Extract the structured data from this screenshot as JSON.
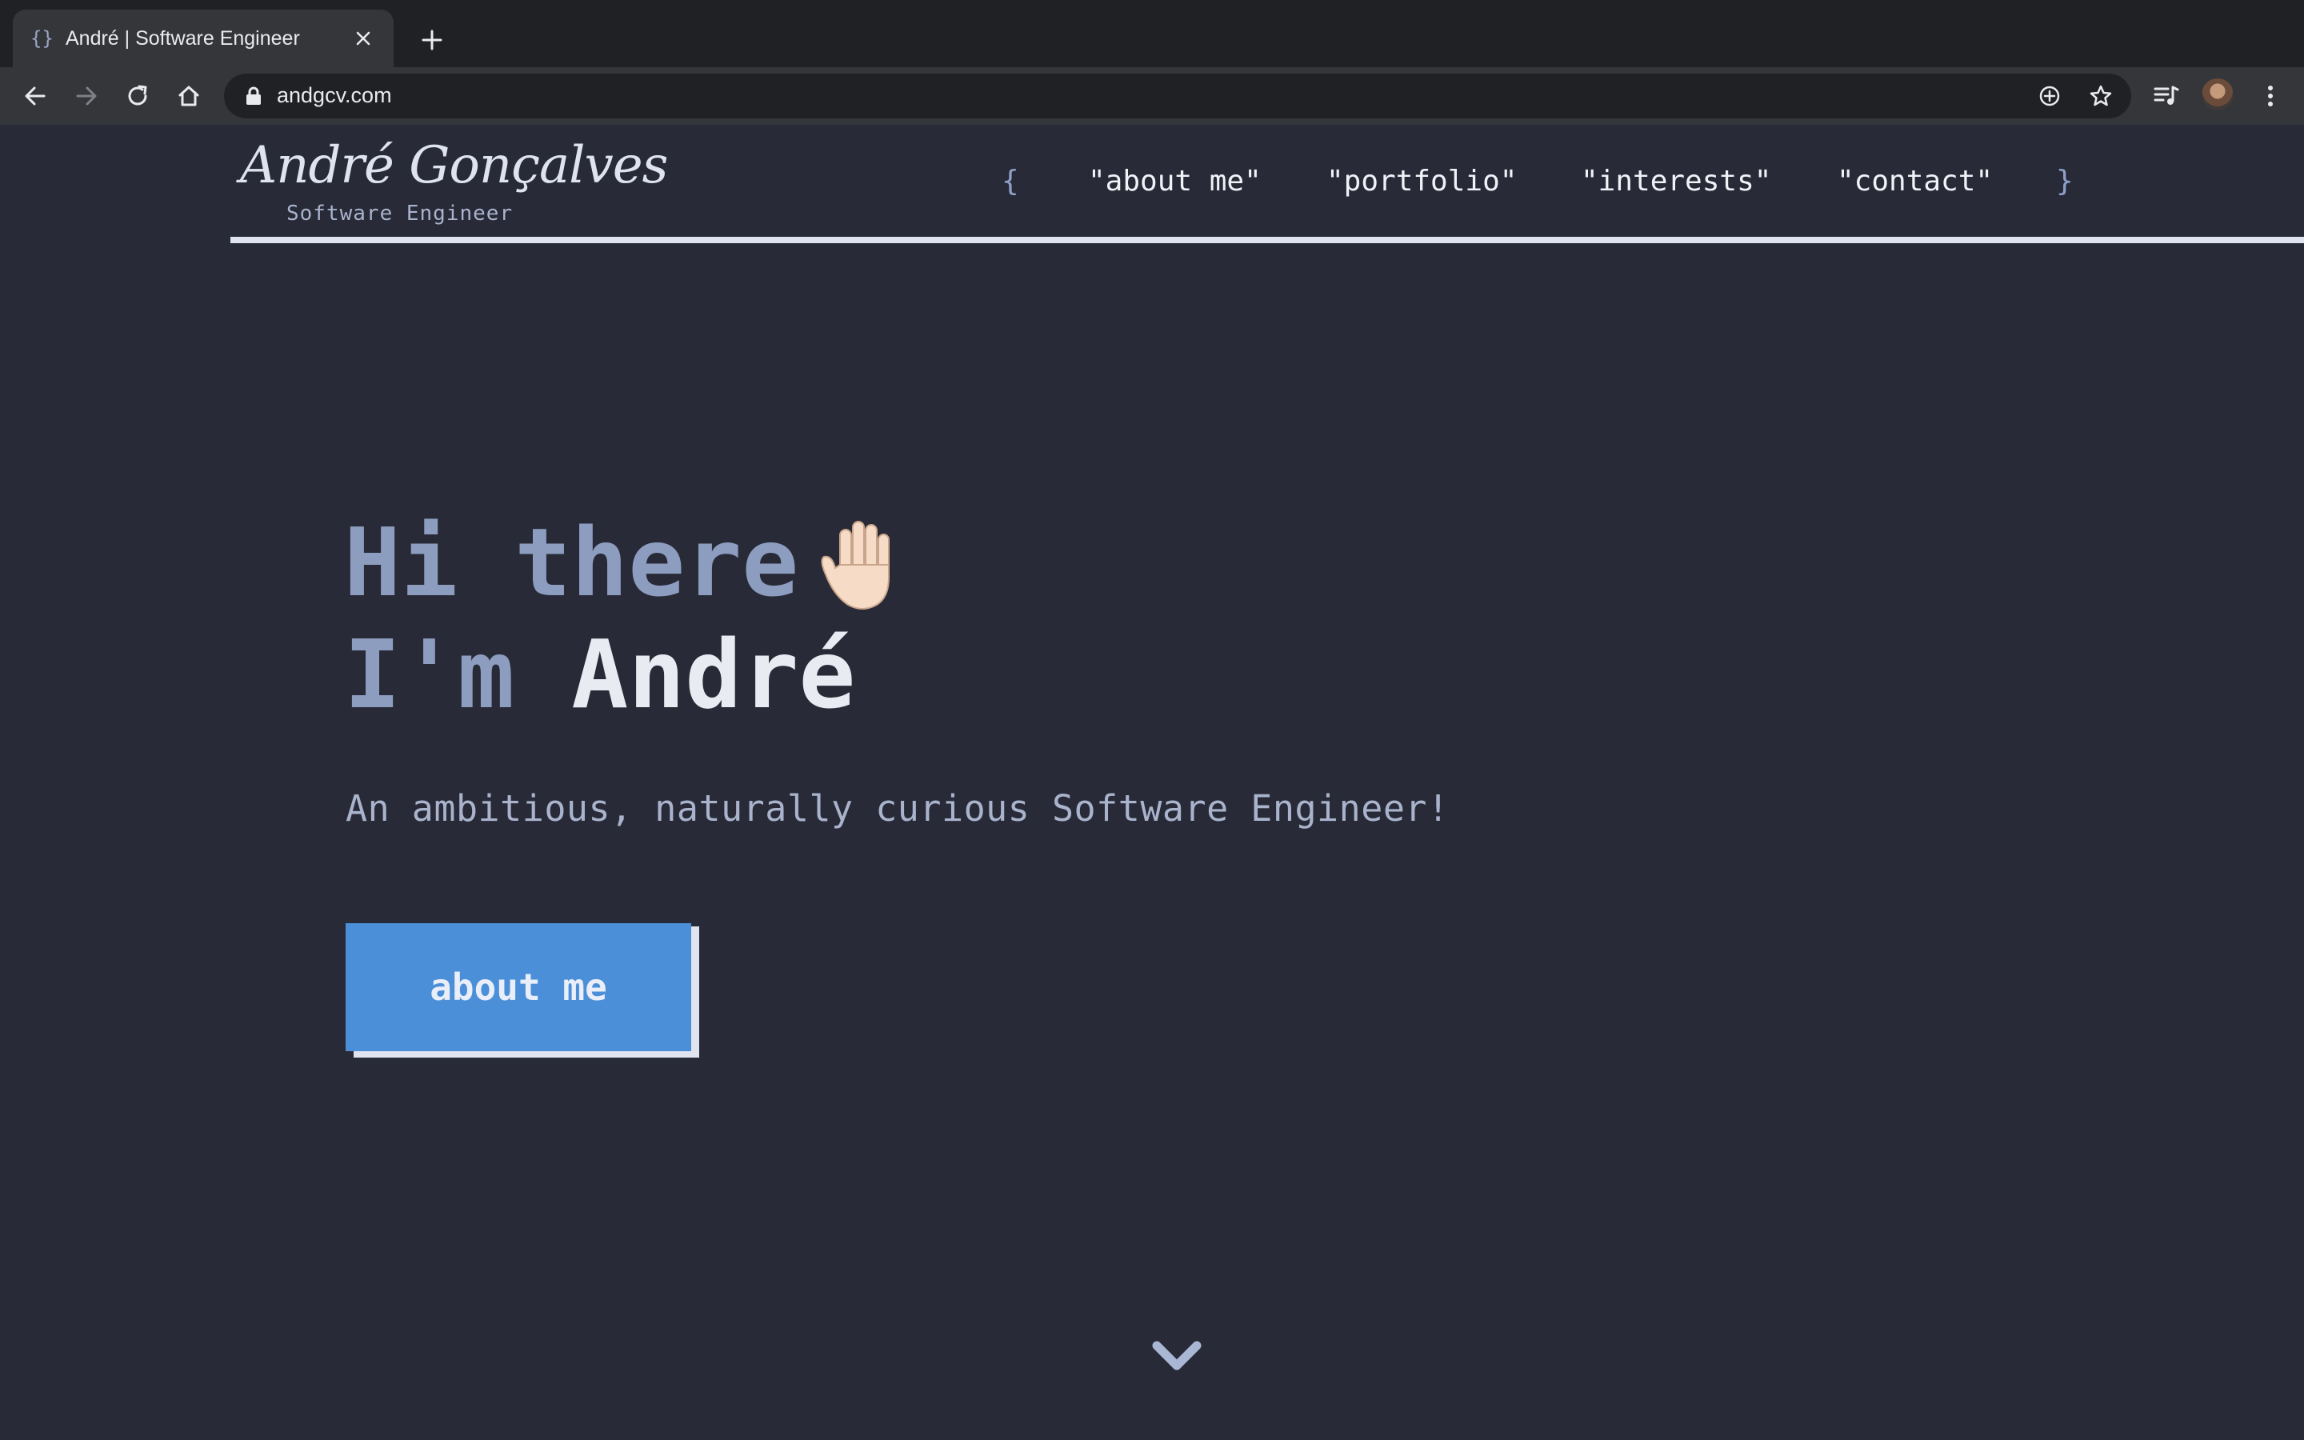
{
  "browser": {
    "tab": {
      "favicon": "{}",
      "title": "André | Software Engineer"
    },
    "url": "andgcv.com"
  },
  "header": {
    "brand_name": "André Gonçalves",
    "brand_subtitle": "Software Engineer",
    "nav": {
      "open_brace": "{",
      "items": [
        "\"about me\"",
        "\"portfolio\"",
        "\"interests\"",
        "\"contact\""
      ],
      "close_brace": "}"
    }
  },
  "hero": {
    "greeting": "Hi there",
    "greeting_icon": "raised-hand-icon",
    "intro_prefix": "I'm",
    "intro_name": "André",
    "tagline": "An ambitious, naturally curious Software Engineer!",
    "cta_label": "about me",
    "scroll_icon": "chevron-down-icon"
  },
  "colors": {
    "background": "#282a37",
    "accent": "#4a8fd8",
    "muted_text": "#8d9dc0",
    "light_text": "#e9ebf2"
  }
}
